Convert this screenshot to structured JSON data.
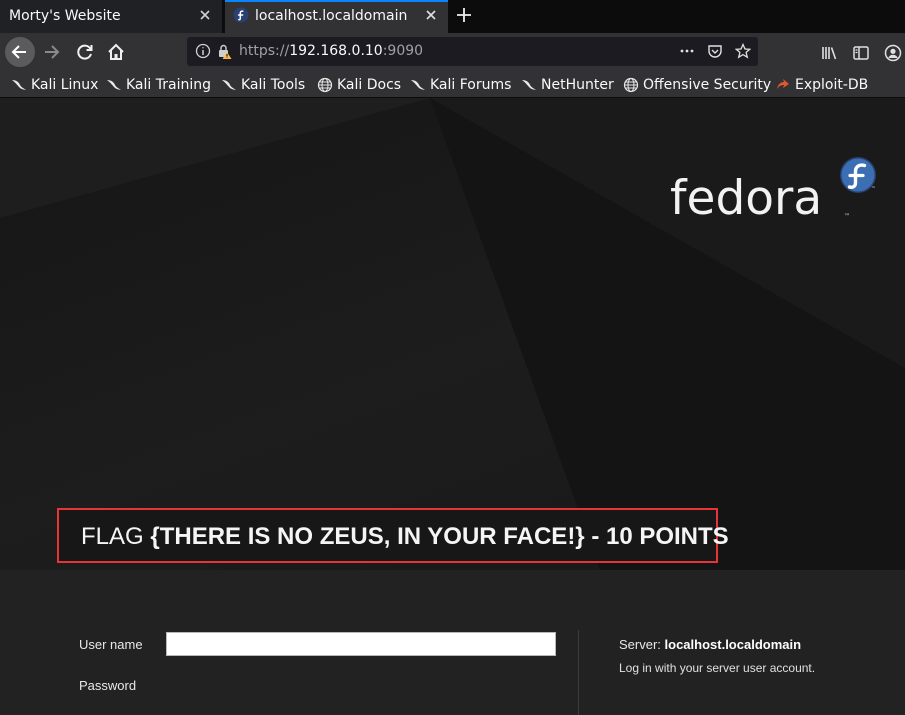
{
  "tabs": [
    {
      "title": "Morty's Website",
      "active": false
    },
    {
      "title": "localhost.localdomain",
      "active": true
    }
  ],
  "url": {
    "scheme": "https://",
    "host": "192.168.0.10",
    "port": ":9090"
  },
  "bookmarks": [
    {
      "label": "Kali Linux",
      "icon": "kali-dragon-icon"
    },
    {
      "label": "Kali Training",
      "icon": "kali-dragon-icon"
    },
    {
      "label": "Kali Tools",
      "icon": "kali-dragon-icon"
    },
    {
      "label": "Kali Docs",
      "icon": "globe-icon"
    },
    {
      "label": "Kali Forums",
      "icon": "kali-dragon-icon"
    },
    {
      "label": "NetHunter",
      "icon": "kali-dragon-icon"
    },
    {
      "label": "Offensive Security",
      "icon": "globe-icon"
    },
    {
      "label": "Exploit-DB",
      "icon": "exploit-db-icon"
    }
  ],
  "logo": {
    "text": "fedora",
    "tm": "™"
  },
  "flag": {
    "prefix": "FLAG ",
    "value": "{THERE IS NO ZEUS, IN YOUR FACE!} - 10 POINTS"
  },
  "login": {
    "username_label": "User name",
    "username_value": "",
    "password_label": "Password",
    "server_label": "Server: ",
    "server_value": "localhost.localdomain",
    "note": "Log in with your server user account."
  },
  "colors": {
    "accent": "#0a84ff",
    "flag_border": "#e6343a",
    "fedora_blue": "#3c6eb4"
  }
}
